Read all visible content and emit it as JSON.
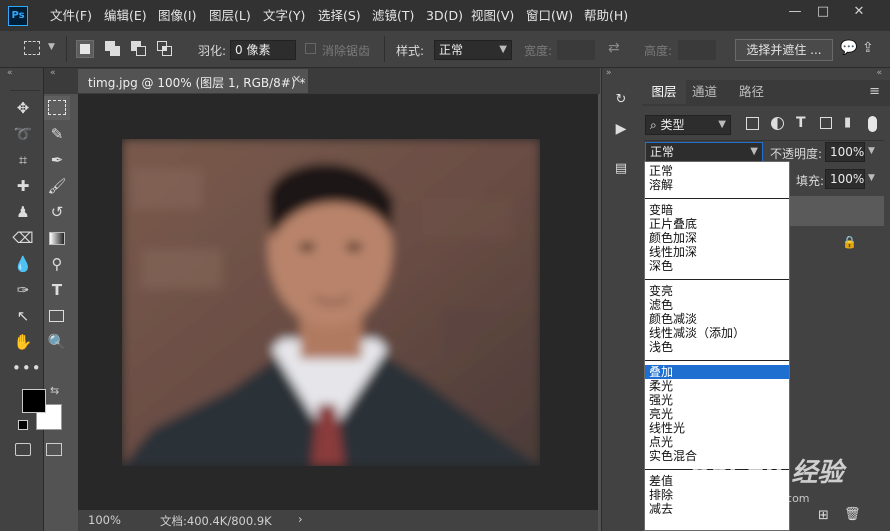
{
  "app": {
    "logo_text": "Ps"
  },
  "menubar": {
    "items": [
      "文件(F)",
      "编辑(E)",
      "图像(I)",
      "图层(L)",
      "文字(Y)",
      "选择(S)",
      "滤镜(T)",
      "3D(D)",
      "视图(V)",
      "窗口(W)",
      "帮助(H)"
    ]
  },
  "window_controls": {
    "minimize": "—",
    "maximize": "□",
    "close": "✕"
  },
  "options": {
    "feather_label": "羽化:",
    "feather_value": "0 像素",
    "antialias_label": "消除锯齿",
    "style_label": "样式:",
    "style_value": "正常",
    "width_label": "宽度:",
    "height_label": "高度:",
    "select_mask_button": "选择并遮住 ..."
  },
  "document": {
    "tab_title": "timg.jpg @ 100% (图层 1, RGB/8#) *",
    "tab_close": "✕"
  },
  "status": {
    "zoom": "100%",
    "doc_info": "文档:400.4K/800.9K",
    "arrow": "›"
  },
  "layers_panel": {
    "tabs": [
      "图层",
      "通道",
      "路径"
    ],
    "filter_label": "类型",
    "blend_mode_value": "正常",
    "opacity_label": "不透明度:",
    "opacity_value": "100%",
    "fill_label": "填充:",
    "fill_value": "100%"
  },
  "blend_modes": {
    "group1": [
      "正常",
      "溶解"
    ],
    "group2": [
      "变暗",
      "正片叠底",
      "颜色加深",
      "线性加深",
      "深色"
    ],
    "group3": [
      "变亮",
      "滤色",
      "颜色减淡",
      "线性减淡（添加）",
      "浅色"
    ],
    "group4": [
      "叠加",
      "柔光",
      "强光",
      "亮光",
      "线性光",
      "点光",
      "实色混合"
    ],
    "group5": [
      "差值",
      "排除",
      "减去"
    ],
    "selected": "叠加"
  },
  "watermark": {
    "text": "Bai du 经验",
    "url": "jingyan.baidu.com"
  },
  "colors": {
    "accent": "#31a8ff",
    "selection": "#1e6fd0",
    "panel": "#424242",
    "menubar": "#323232"
  }
}
